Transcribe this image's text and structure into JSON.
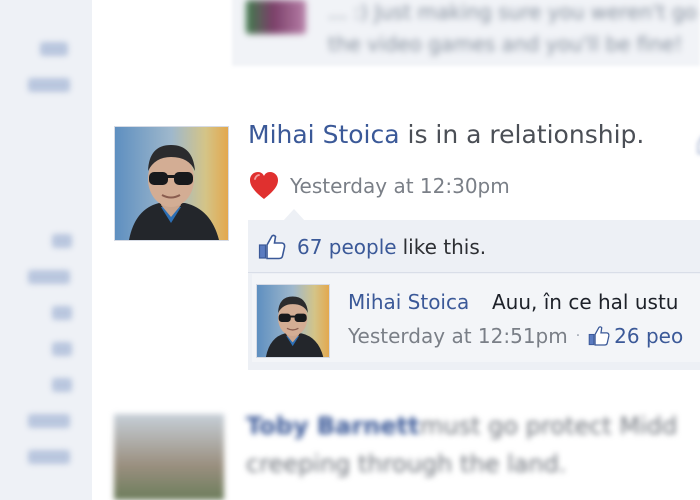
{
  "top_story": {
    "line1": "... :) Just making sure you weren't go",
    "line2": "the video games and you'll be fine!"
  },
  "story": {
    "author": "Mihai Stoica",
    "action": " is in a relationship.",
    "timestamp": "Yesterday at 12:30pm",
    "icon": "heart-icon"
  },
  "feedback": {
    "likes_count": "67 people",
    "likes_suffix": "like this.",
    "comment": {
      "author": "Mihai Stoica",
      "text": "Auu, în ce hal ustu",
      "timestamp": "Yesterday at 12:51pm",
      "separator": "·",
      "likes": "26 peo"
    }
  },
  "bottom_story": {
    "author": "Toby Barnett",
    "text": "must go protect Midd",
    "text2": "creeping through the land."
  },
  "colors": {
    "link": "#3b5998",
    "heart": "#e0302f",
    "background": "#ffffff",
    "feedback_bg": "#edf0f5"
  }
}
